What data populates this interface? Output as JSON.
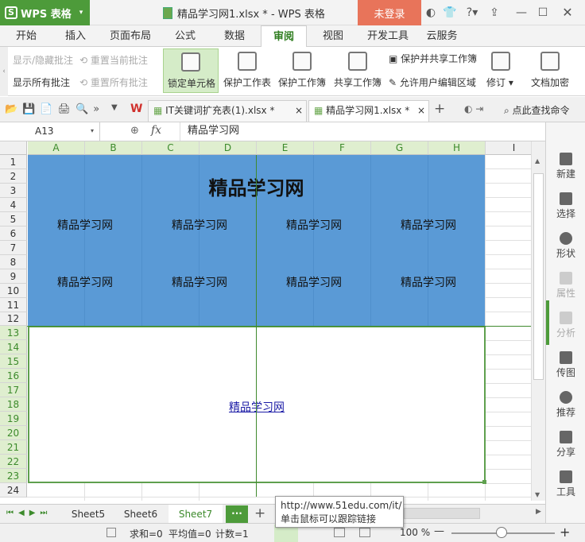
{
  "app": {
    "name": "WPS 表格",
    "logo": "S"
  },
  "window": {
    "title": "精品学习网1.xlsx * - WPS 表格",
    "login": "未登录"
  },
  "ribbon_tabs": [
    "开始",
    "插入",
    "页面布局",
    "公式",
    "数据",
    "审阅",
    "视图",
    "开发工具",
    "云服务"
  ],
  "active_tab": "审阅",
  "ribbon": {
    "show_hide_comments": "显示/隐藏批注",
    "reset_current_comment": "重置当前批注",
    "show_all_comments": "显示所有批注",
    "reset_all_comments": "重置所有批注",
    "lock_cells": "锁定单元格",
    "protect_sheet": "保护工作表",
    "protect_workbook": "保护工作簿",
    "share_workbook": "共享工作簿",
    "protect_and_share": "保护并共享工作簿",
    "allow_edit_ranges": "允许用户编辑区域",
    "track_changes": "修订",
    "encrypt": "文档加密"
  },
  "doc_tabs": [
    {
      "label": "IT关键词扩充表(1).xlsx *"
    },
    {
      "label": "精品学习网1.xlsx *"
    }
  ],
  "search_cmd": "点此查找命令",
  "name_box": "A13",
  "fx": "fx",
  "formula": "精品学习网",
  "columns": [
    "A",
    "B",
    "C",
    "D",
    "E",
    "F",
    "G",
    "H",
    "I"
  ],
  "rows": [
    "1",
    "2",
    "3",
    "4",
    "5",
    "6",
    "7",
    "8",
    "9",
    "10",
    "11",
    "12",
    "13",
    "14",
    "15",
    "16",
    "17",
    "18",
    "19",
    "20",
    "21",
    "22",
    "23",
    "24"
  ],
  "cells": {
    "title": "精品学习网",
    "grid_text": "精品学习网",
    "link": "精品学习网"
  },
  "right_panel": [
    "新建",
    "选择",
    "形状",
    "属性",
    "分析",
    "传图",
    "推荐",
    "分享",
    "工具"
  ],
  "sheets": [
    "Sheet5",
    "Sheet6",
    "Sheet7"
  ],
  "active_sheet": "Sheet7",
  "more_sheets": "···",
  "status": {
    "sum": "求和=0",
    "avg": "平均值=0",
    "count": "计数=1",
    "zoom": "100 %"
  },
  "tooltip": {
    "url": "http://www.51edu.com/it/",
    "hint": "单击鼠标可以跟踪链接"
  },
  "colors": {
    "accent": "#4d9b3a",
    "fill_blue": "#5a9ad6",
    "login": "#e8745a"
  }
}
